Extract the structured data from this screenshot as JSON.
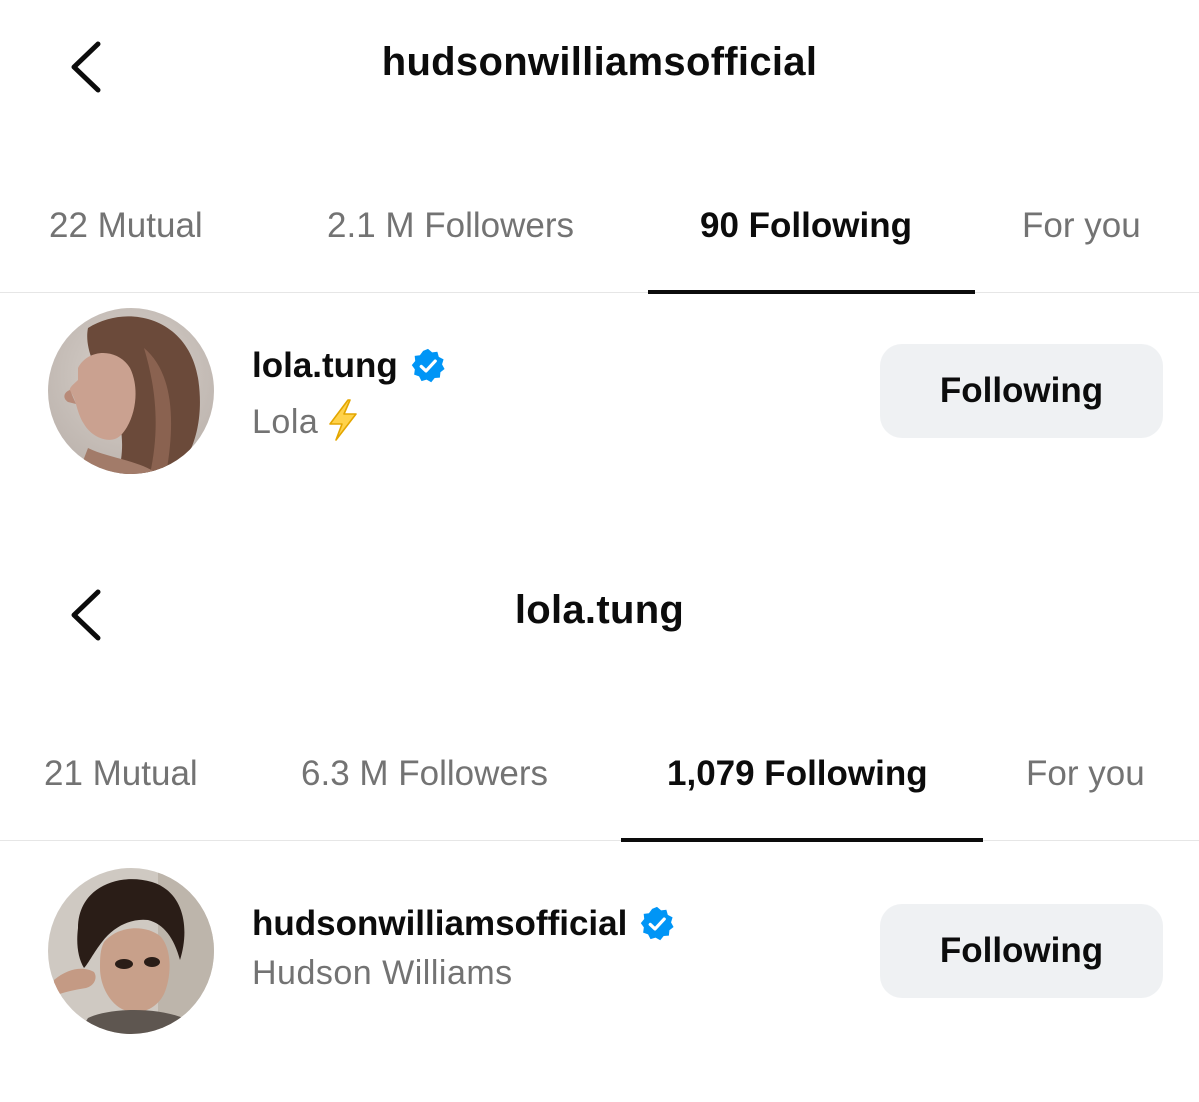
{
  "screens": [
    {
      "title": "hudsonwilliamsofficial",
      "tabs": [
        {
          "label": "22 Mutual",
          "active": false
        },
        {
          "label": "2.1 M Followers",
          "active": false
        },
        {
          "label": "90 Following",
          "active": true
        },
        {
          "label": "For you",
          "active": false
        }
      ],
      "user": {
        "username": "lola.tung",
        "verified": true,
        "full_name": "Lola",
        "name_emoji_icon": "lightning-bolt-icon",
        "button_label": "Following"
      }
    },
    {
      "title": "lola.tung",
      "tabs": [
        {
          "label": "21 Mutual",
          "active": false
        },
        {
          "label": "6.3 M Followers",
          "active": false
        },
        {
          "label": "1,079 Following",
          "active": true
        },
        {
          "label": "For you",
          "active": false
        }
      ],
      "user": {
        "username": "hudsonwilliamsofficial",
        "verified": true,
        "full_name": "Hudson Williams",
        "button_label": "Following"
      }
    }
  ],
  "colors": {
    "text_primary": "#0c0c0c",
    "text_secondary": "#737373",
    "verified_blue": "#0095f6",
    "button_bg": "#eff1f3",
    "divider": "#e6e6e6",
    "bolt_yellow": "#f5b800"
  }
}
